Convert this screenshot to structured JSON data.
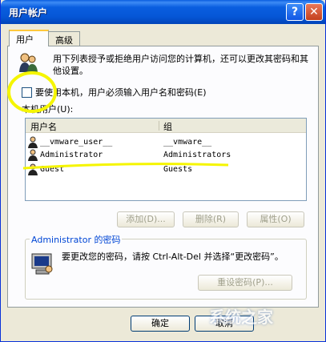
{
  "window": {
    "title": "用户帐户"
  },
  "titlebar": {
    "help_label": "?",
    "close_label": "✕"
  },
  "tabs": [
    {
      "label": "用户"
    },
    {
      "label": "高级"
    }
  ],
  "intro": {
    "text": "用下列表授予或拒绝用户访问您的计算机，还可以更改其密码和其他设置。"
  },
  "require_login": {
    "label": "要使用本机，用户必须输入用户名和密码(E)",
    "checked": false
  },
  "local_users": {
    "label": "本机用户(U):",
    "columns": [
      "用户名",
      "组"
    ],
    "rows": [
      {
        "name": "__vmware_user__",
        "group": "__vmware__"
      },
      {
        "name": "Administrator",
        "group": "Administrators"
      },
      {
        "name": "Guest",
        "group": "Guests"
      }
    ]
  },
  "actions": {
    "add_label": "添加(D)...",
    "remove_label": "删除(R)",
    "properties_label": "属性(O)"
  },
  "password_group": {
    "title": "Administrator 的密码",
    "text": "要更改您的密码，请按 Ctrl-Alt-Del 并选择“更改密码”。",
    "reset_label": "重设密码(P)..."
  },
  "dialog": {
    "ok_label": "确定",
    "cancel_label": "取消"
  },
  "watermark": {
    "text": "系统之家"
  },
  "colors": {
    "titlebar": "#0a5ee0",
    "highlight": "#f5f500",
    "panel": "#fcfcfe"
  }
}
